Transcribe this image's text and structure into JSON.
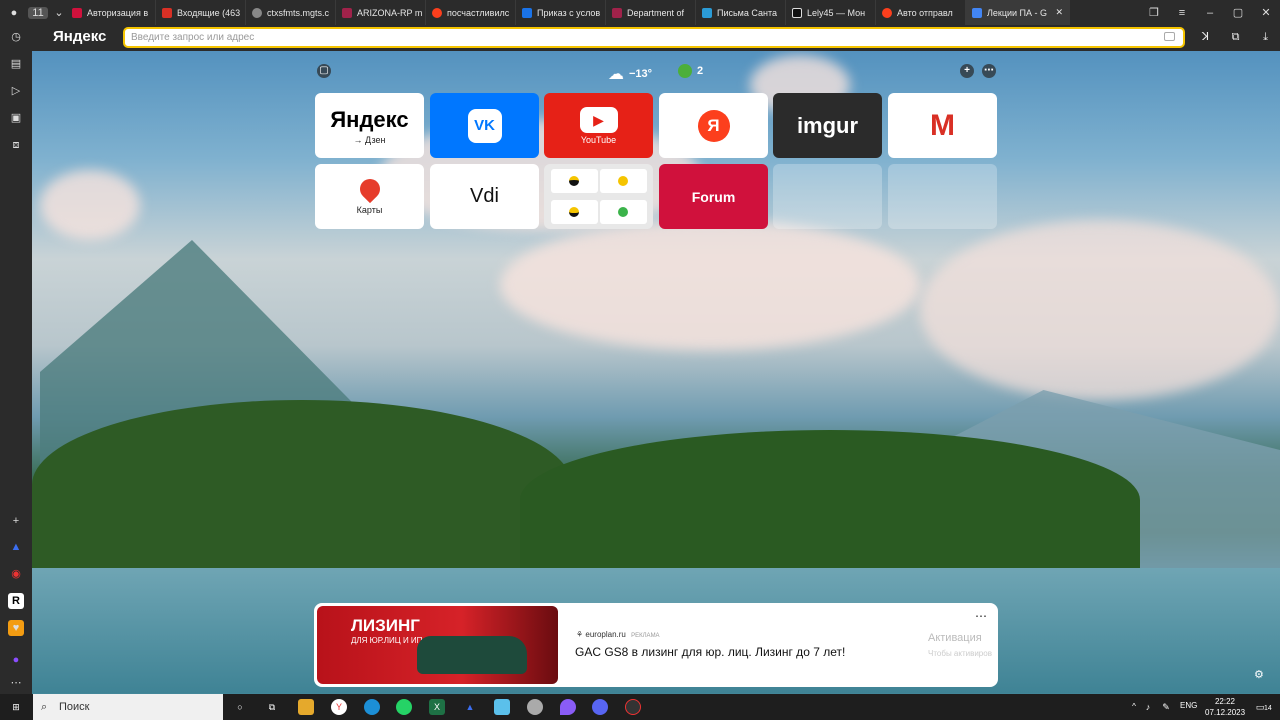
{
  "tabs": [
    "Авторизация в",
    "Входящие (463",
    "ctxsfmts.mgts.c",
    "ARIZONA-RP m",
    "посчастливилс",
    "Приказ с услов",
    "Department of",
    "Письма Санта",
    "Lely45 — Мон",
    "Авто отправл",
    "Лекции ПА - G"
  ],
  "tab_counter": "11",
  "browser_brand": "Яндекс",
  "search_placeholder": "Введите запрос или адрес",
  "weather": "−13°",
  "notifications": "2",
  "tiles": [
    {
      "name": "Яндекс",
      "sub": "→ Дзен"
    },
    {
      "name": "VK",
      "sub": ""
    },
    {
      "name": "YouTube",
      "sub": "YouTube"
    },
    {
      "name": "Я",
      "sub": ""
    },
    {
      "name": "imgur",
      "sub": ""
    },
    {
      "name": "M",
      "sub": ""
    },
    {
      "name": "Карты",
      "sub": "Карты"
    },
    {
      "name": "Vdi",
      "sub": ""
    },
    {
      "name": "group",
      "sub": ""
    },
    {
      "name": "Forum",
      "sub": ""
    }
  ],
  "ad": {
    "image_title": "ЛИЗИНГ",
    "image_sub": "ДЛЯ ЮР.ЛИЦ И ИП",
    "domain": "europlan.ru",
    "tag": "РЕКЛАМА",
    "text": "GAC GS8 в лизинг для юр. лиц. Лизинг до 7 лет!",
    "activation_title": "Активация",
    "activation_sub": "Чтобы активиров"
  },
  "taskbar": {
    "search": "Поиск",
    "lang": "ENG",
    "time": "22:22",
    "date": "07.12.2023",
    "badge": "14"
  },
  "colors": {
    "accent": "#f5c400",
    "youtube": "#e62117",
    "vk": "#0077ff",
    "forum": "#d0113c",
    "imgur": "#2b2b2b"
  }
}
